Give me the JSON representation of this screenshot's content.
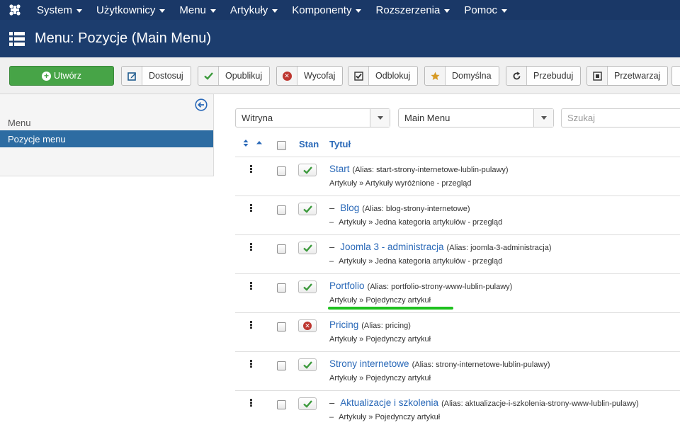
{
  "topnav": {
    "items": [
      "System",
      "Użytkownicy",
      "Menu",
      "Artykuły",
      "Komponenty",
      "Rozszerzenia",
      "Pomoc"
    ]
  },
  "header": {
    "title": "Menu: Pozycje (Main Menu)"
  },
  "toolbar": {
    "create_label": "Utwórz",
    "buttons": [
      {
        "label": "Dostosuj",
        "icon": "edit-icon"
      },
      {
        "label": "Opublikuj",
        "icon": "check-icon"
      },
      {
        "label": "Wycofaj",
        "icon": "unpublish-icon"
      },
      {
        "label": "Odblokuj",
        "icon": "checkin-icon"
      },
      {
        "label": "Domyślna",
        "icon": "star-icon"
      },
      {
        "label": "Przebuduj",
        "icon": "refresh-icon"
      },
      {
        "label": "Przetwarzaj",
        "icon": "batch-icon"
      }
    ]
  },
  "sidebar": {
    "section_label": "Menu",
    "active_item": "Pozycje menu"
  },
  "filters": {
    "client": "Witryna",
    "menu": "Main Menu",
    "search_placeholder": "Szukaj"
  },
  "table": {
    "headers": {
      "state": "Stan",
      "title": "Tytuł"
    },
    "rows": [
      {
        "prefix": "",
        "title": "Start",
        "alias": "(Alias: start-strony-internetowe-lublin-pulawy)",
        "type": "Artykuły » Artykuły wyróżnione - przegląd",
        "state": "published"
      },
      {
        "prefix": "–",
        "title": "Blog",
        "alias": "(Alias: blog-strony-internetowe)",
        "type": "Artykuły » Jedna kategoria artykułów - przegląd",
        "state": "published"
      },
      {
        "prefix": "–",
        "title": "Joomla 3 - administracja",
        "alias": "(Alias: joomla-3-administracja)",
        "type": "Artykuły » Jedna kategoria artykułów - przegląd",
        "state": "published"
      },
      {
        "prefix": "",
        "title": "Portfolio",
        "alias": "(Alias: portfolio-strony-www-lublin-pulawy)",
        "type": "Artykuły » Pojedynczy artykuł",
        "state": "published"
      },
      {
        "prefix": "",
        "title": "Pricing",
        "alias": "(Alias: pricing)",
        "type": "Artykuły » Pojedynczy artykuł",
        "state": "unpublished"
      },
      {
        "prefix": "",
        "title": "Strony internetowe",
        "alias": "(Alias: strony-internetowe-lublin-pulawy)",
        "type": "Artykuły » Pojedynczy artykuł",
        "state": "published"
      },
      {
        "prefix": "–",
        "title": "Aktualizacje i szkolenia",
        "alias": "(Alias: aktualizacje-i-szkolenia-strony-www-lublin-pulawy)",
        "type": "Artykuły » Pojedynczy artykuł",
        "state": "published"
      }
    ]
  },
  "colors": {
    "nav_bg": "#1a3867",
    "header_bg": "#1c3d6e",
    "create_green": "#47a447",
    "link_blue": "#2a69b8",
    "active_blue": "#2d6ca2",
    "check_green": "#3c9a3c",
    "unpublish_red": "#bd362f",
    "highlight_green": "#1ec11e"
  }
}
